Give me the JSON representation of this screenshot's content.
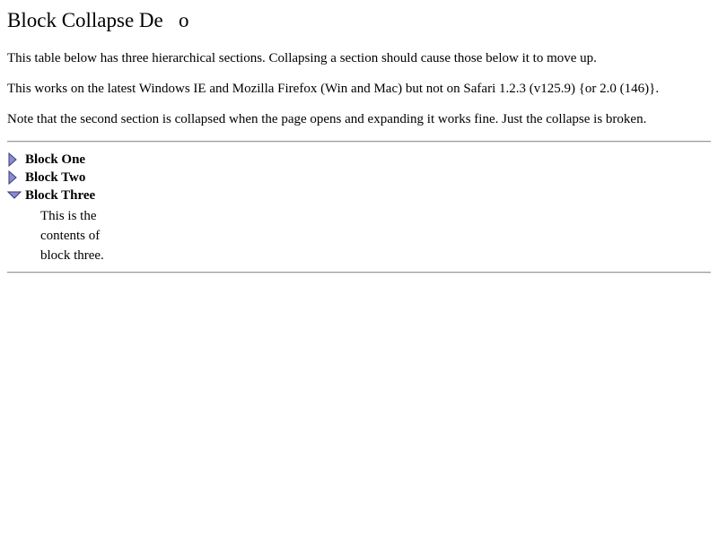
{
  "page": {
    "title": "Block Collapse De   o",
    "paragraphs": [
      "This table below has three hierarchical sections. Collapsing a section should cause those below it to move up.",
      "This works on the latest Windows IE and Mozilla Firefox (Win and Mac) but not on Safari 1.2.3 (v125.9) {or 2.0 (146)}.",
      "Note that the second section is collapsed when the page opens and expanding it works fine. Just the collapse is broken."
    ]
  },
  "blocks": [
    {
      "label": "Block One",
      "state": "collapsed",
      "icon": "triangle-right-icon"
    },
    {
      "label": "Block Two",
      "state": "collapsed",
      "icon": "triangle-right-icon"
    },
    {
      "label": "Block Three",
      "state": "expanded",
      "icon": "triangle-down-icon",
      "content_lines": [
        "This is the",
        "contents of",
        "block three."
      ]
    }
  ],
  "colors": {
    "triangle_fill": "#8c8cd2",
    "triangle_stroke": "#3a3a7a",
    "rule": "#9a9a9a"
  }
}
